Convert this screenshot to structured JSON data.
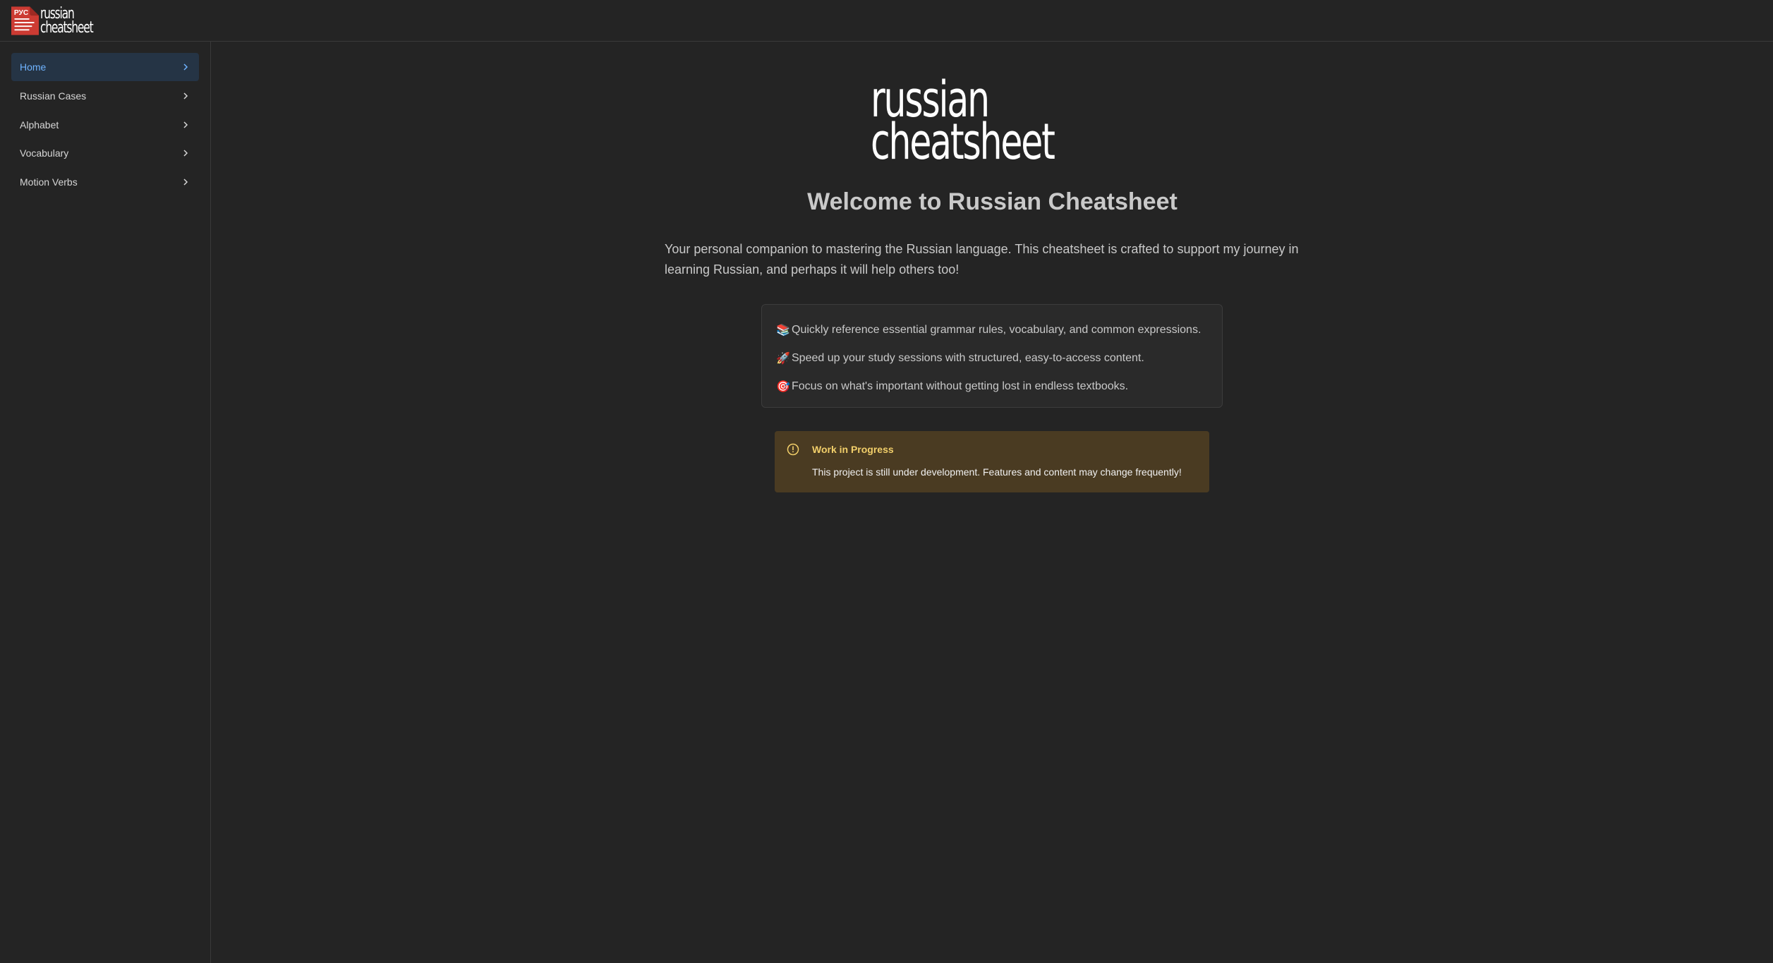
{
  "app": {
    "logo_badge": "РУС",
    "logo_word1": "russian",
    "logo_word2": "cheatsheet"
  },
  "sidebar": {
    "items": [
      {
        "label": "Home",
        "active": true
      },
      {
        "label": "Russian Cases"
      },
      {
        "label": "Alphabet"
      },
      {
        "label": "Vocabulary"
      },
      {
        "label": "Motion Verbs"
      }
    ]
  },
  "main": {
    "title": "Welcome to Russian Cheatsheet",
    "intro": "Your personal companion to mastering the Russian language. This cheatsheet is crafted to support my journey in learning Russian, and perhaps it will help others too!",
    "features": [
      {
        "icon": "📚",
        "text": "Quickly reference essential grammar rules, vocabulary, and common expressions."
      },
      {
        "icon": "🚀",
        "text": "Speed up your study sessions with structured, easy-to-access content."
      },
      {
        "icon": "🎯",
        "text": "Focus on what's important without getting lost in endless textbooks."
      }
    ],
    "warning": {
      "title": "Work in Progress",
      "body": "This project is still under development. Features and content may change frequently!"
    }
  },
  "colors": {
    "background": "#242424",
    "brand_red": "#cc3b33",
    "active_nav_bg": "#253445",
    "active_nav_text": "#6fb3ff",
    "warning_bg": "#4a3b22",
    "warning_title": "#f2cf6a"
  }
}
